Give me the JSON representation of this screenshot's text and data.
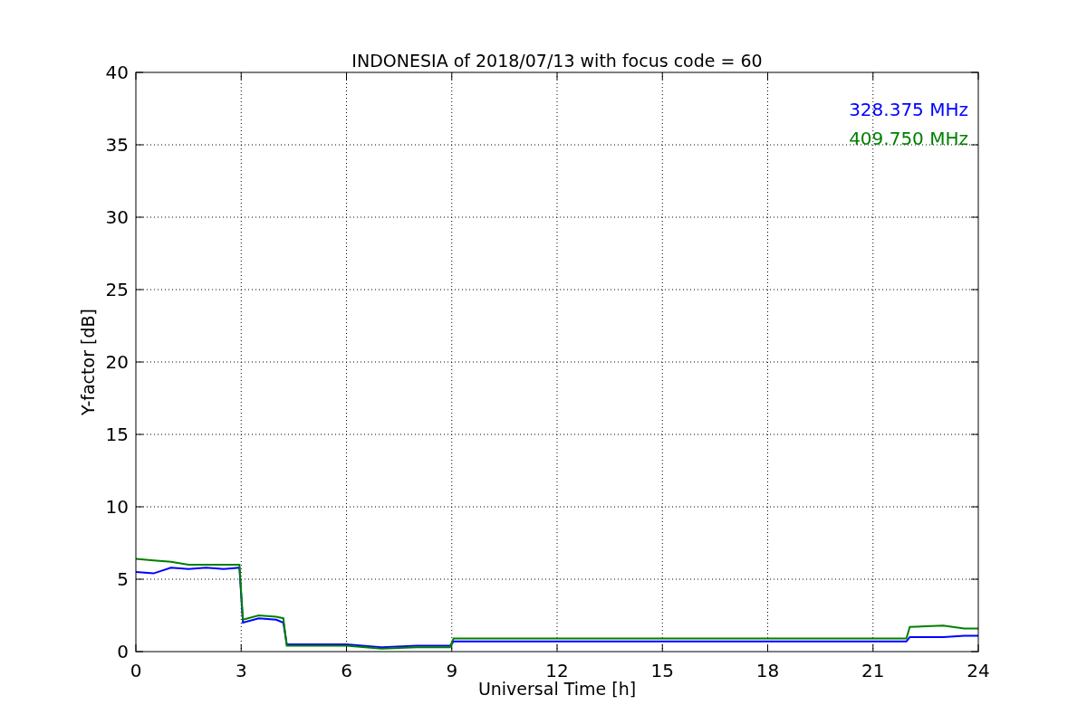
{
  "figure": {
    "chart_data": {
      "type": "line",
      "title": "INDONESIA of 2018/07/13 with focus code = 60",
      "xlabel": "Universal Time [h]",
      "ylabel": "Y-factor [dB]",
      "x": [
        0,
        0.5,
        1,
        1.5,
        2,
        2.5,
        2.95,
        3.05,
        3.5,
        4,
        4.2,
        4.3,
        5,
        6,
        7,
        8,
        8.95,
        9.05,
        12,
        15,
        18,
        21,
        21.95,
        22.05,
        23,
        23.6,
        24
      ],
      "series": [
        {
          "name": "328.375 MHz",
          "color": "#0000ff",
          "values": [
            5.5,
            5.4,
            5.8,
            5.7,
            5.8,
            5.7,
            5.8,
            2.0,
            2.3,
            2.2,
            2.0,
            0.5,
            0.5,
            0.5,
            0.3,
            0.4,
            0.4,
            0.7,
            0.7,
            0.7,
            0.7,
            0.7,
            0.7,
            1.0,
            1.0,
            1.1,
            1.1
          ]
        },
        {
          "name": "409.750 MHz",
          "color": "#008000",
          "values": [
            6.4,
            6.3,
            6.2,
            6.0,
            6.0,
            6.0,
            6.0,
            2.2,
            2.5,
            2.4,
            2.3,
            0.4,
            0.4,
            0.4,
            0.2,
            0.3,
            0.3,
            0.9,
            0.9,
            0.9,
            0.9,
            0.9,
            0.9,
            1.7,
            1.8,
            1.6,
            1.6
          ]
        }
      ],
      "grid": true,
      "xlim": [
        0,
        24
      ],
      "ylim": [
        0,
        40
      ],
      "xticks": [
        0,
        3,
        6,
        9,
        12,
        15,
        18,
        21,
        24
      ],
      "yticks": [
        0,
        5,
        10,
        15,
        20,
        25,
        30,
        35,
        40
      ]
    }
  }
}
